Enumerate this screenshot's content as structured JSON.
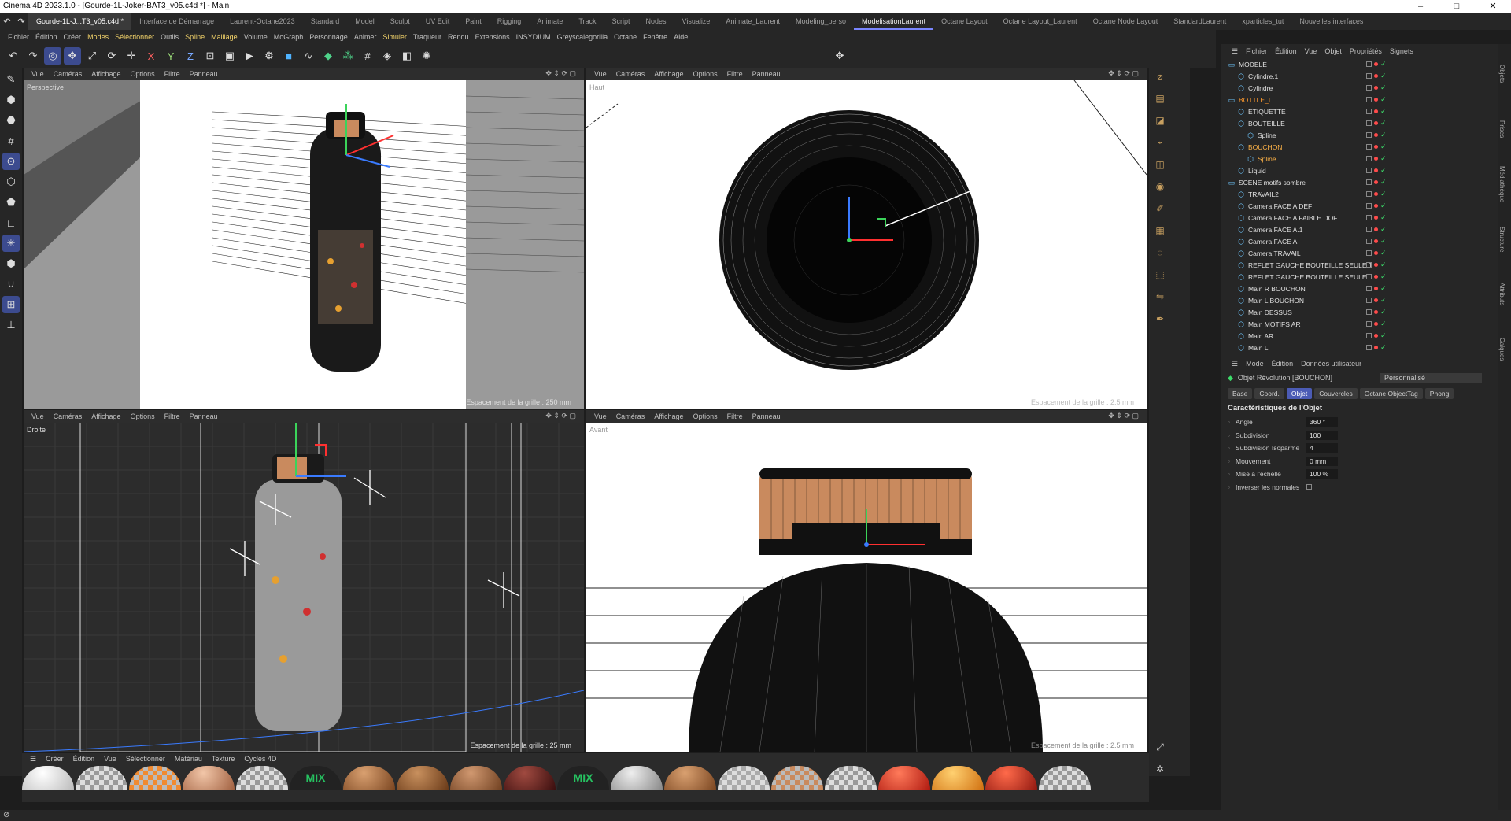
{
  "window": {
    "title": "Cinema 4D 2023.1.0 - [Gourde-1L-Joker-BAT3_v05.c4d *] - Main",
    "min": "–",
    "max": "□",
    "close": "✕"
  },
  "tabs": [
    {
      "label": "Gourde-1L-J...T3_v05.c4d *",
      "kind": "doc"
    },
    {
      "label": "Interface de Démarrage",
      "kind": ""
    },
    {
      "label": "Laurent-Octane2023",
      "kind": ""
    },
    {
      "label": "Standard",
      "kind": ""
    },
    {
      "label": "Model",
      "kind": ""
    },
    {
      "label": "Sculpt",
      "kind": ""
    },
    {
      "label": "UV Edit",
      "kind": ""
    },
    {
      "label": "Paint",
      "kind": ""
    },
    {
      "label": "Rigging",
      "kind": ""
    },
    {
      "label": "Animate",
      "kind": ""
    },
    {
      "label": "Track",
      "kind": ""
    },
    {
      "label": "Script",
      "kind": ""
    },
    {
      "label": "Nodes",
      "kind": ""
    },
    {
      "label": "Visualize",
      "kind": ""
    },
    {
      "label": "Animate_Laurent",
      "kind": ""
    },
    {
      "label": "Modeling_perso",
      "kind": ""
    },
    {
      "label": "ModelisationLaurent",
      "kind": "active"
    },
    {
      "label": "Octane Layout",
      "kind": ""
    },
    {
      "label": "Octane Layout_Laurent",
      "kind": ""
    },
    {
      "label": "Octane Node Layout",
      "kind": ""
    },
    {
      "label": "StandardLaurent",
      "kind": ""
    },
    {
      "label": "xparticles_tut",
      "kind": ""
    },
    {
      "label": "Nouvelles interfaces",
      "kind": ""
    }
  ],
  "menu": [
    "Fichier",
    "Édition",
    "Créer",
    "Modes",
    "Sélectionner",
    "Outils",
    "Spline",
    "Maillage",
    "Volume",
    "MoGraph",
    "Personnage",
    "Animer",
    "Simuler",
    "Traqueur",
    "Rendu",
    "Extensions",
    "INSYDIUM",
    "Greyscalegorilla",
    "Octane",
    "Fenêtre",
    "Aide"
  ],
  "menu_highlight": [
    "Modes",
    "Sélectionner",
    "Spline",
    "Maillage",
    "Simuler"
  ],
  "viewports": {
    "menu": [
      "Vue",
      "Caméras",
      "Affichage",
      "Options",
      "Filtre",
      "Panneau"
    ],
    "tl": {
      "label": "Perspective",
      "grid": "Espacement de la grille : 250 mm"
    },
    "tr": {
      "label": "Haut",
      "grid": "Espacement de la grille : 2.5 mm"
    },
    "bl": {
      "label": "Droite",
      "grid": "Espacement de la grille : 25 mm"
    },
    "br": {
      "label": "Avant",
      "grid": "Espacement de la grille : 2.5 mm"
    }
  },
  "materials": {
    "menu": [
      "Créer",
      "Édition",
      "Vue",
      "Sélectionner",
      "Matériau",
      "Texture",
      "Cycles 4D"
    ],
    "mix_label": "MIX"
  },
  "objects_panel": {
    "menu": [
      "Fichier",
      "Édition",
      "Vue",
      "Objet",
      "Propriétés",
      "Signets"
    ],
    "items": [
      {
        "name": "MODELE",
        "indent": 0,
        "color": "#e0e0e0"
      },
      {
        "name": "Cylindre.1",
        "indent": 1,
        "color": "#e0e0e0"
      },
      {
        "name": "Cylindre",
        "indent": 1,
        "color": "#e0e0e0"
      },
      {
        "name": "BOTTLE_I",
        "indent": 0,
        "color": "#ff9a2e"
      },
      {
        "name": "ETIQUETTE",
        "indent": 1,
        "color": "#e0e0e0"
      },
      {
        "name": "BOUTEILLE",
        "indent": 1,
        "color": "#e0e0e0"
      },
      {
        "name": "Spline",
        "indent": 2,
        "color": "#e0e0e0"
      },
      {
        "name": "BOUCHON",
        "indent": 1,
        "color": "#ffb347"
      },
      {
        "name": "Spline",
        "indent": 2,
        "color": "#ffb347"
      },
      {
        "name": "Liquid",
        "indent": 1,
        "color": "#e0e0e0"
      },
      {
        "name": "SCENE motifs sombre",
        "indent": 0,
        "color": "#e0e0e0"
      },
      {
        "name": "TRAVAIL2",
        "indent": 1,
        "color": "#e0e0e0"
      },
      {
        "name": "Camera FACE A DEF",
        "indent": 1,
        "color": "#e0e0e0"
      },
      {
        "name": "Camera FACE A FAIBLE DOF",
        "indent": 1,
        "color": "#e0e0e0"
      },
      {
        "name": "Camera FACE A.1",
        "indent": 1,
        "color": "#e0e0e0"
      },
      {
        "name": "Camera FACE A",
        "indent": 1,
        "color": "#e0e0e0"
      },
      {
        "name": "Camera TRAVAIL",
        "indent": 1,
        "color": "#e0e0e0"
      },
      {
        "name": "REFLET GAUCHE BOUTEILLE SEULE.1",
        "indent": 1,
        "color": "#e0e0e0"
      },
      {
        "name": "REFLET GAUCHE BOUTEILLE SEULE",
        "indent": 1,
        "color": "#e0e0e0"
      },
      {
        "name": "Main R BOUCHON",
        "indent": 1,
        "color": "#e0e0e0"
      },
      {
        "name": "Main L BOUCHON",
        "indent": 1,
        "color": "#e0e0e0"
      },
      {
        "name": "Main DESSUS",
        "indent": 1,
        "color": "#e0e0e0"
      },
      {
        "name": "Main MOTIFS AR",
        "indent": 1,
        "color": "#e0e0e0"
      },
      {
        "name": "Main AR",
        "indent": 1,
        "color": "#e0e0e0"
      },
      {
        "name": "Main L",
        "indent": 1,
        "color": "#e0e0e0"
      }
    ]
  },
  "attributes": {
    "menu": [
      "Mode",
      "Édition",
      "Données utilisateur"
    ],
    "object": "Objet Révolution [BOUCHON]",
    "preset": "Personnalisé",
    "tabs": [
      "Base",
      "Coord.",
      "Objet",
      "Couvercles",
      "Octane ObjectTag",
      "Phong"
    ],
    "active_tab": "Objet",
    "section": "Caractéristiques de l'Objet",
    "rows": [
      {
        "label": "Angle",
        "value": "360 °"
      },
      {
        "label": "Subdivision",
        "value": "100"
      },
      {
        "label": "Subdivision Isoparme",
        "value": "4"
      },
      {
        "label": "Mouvement",
        "value": "0 mm"
      },
      {
        "label": "Mise à l'échelle",
        "value": "100 %"
      },
      {
        "label": "Inverser les normales",
        "value": ""
      }
    ]
  },
  "side_tabs": [
    "Objets",
    "Prises",
    "Médiathèque",
    "Structure",
    "Attributs",
    "Calques"
  ]
}
